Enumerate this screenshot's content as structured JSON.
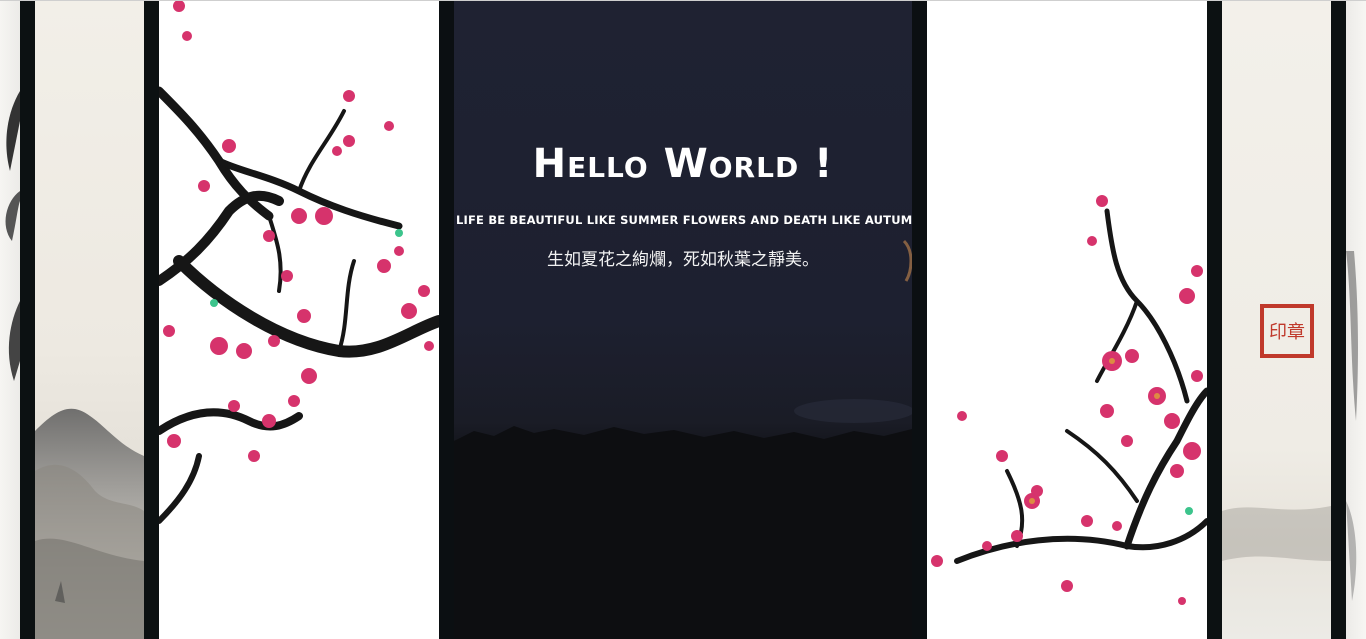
{
  "hero": {
    "title": "Hello World !",
    "subtitle_en": "Life be beautiful like summer flowers and death like autumn leaves",
    "subtitle_cn": "生如夏花之絢爛，死如秋葉之靜美。"
  },
  "seal": {
    "text": "印章"
  },
  "colors": {
    "frame": "#0c1112",
    "night_sky": "#1f2232",
    "paper": "#f2efe8",
    "blossom": "#d6336c",
    "branch": "#1a1a1a",
    "seal": "#c0392b"
  }
}
